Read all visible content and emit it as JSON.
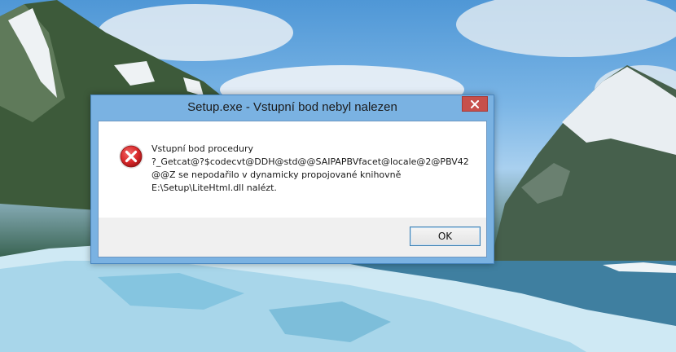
{
  "dialog": {
    "title": "Setup.exe - Vstupní bod nebyl nalezen",
    "message_lines": [
      "Vstupní bod procedury",
      "?_Getcat@?$codecvt@DDH@std@@SAIPAPBVfacet@locale@2@PBV42",
      "@@Z se nepodařilo v dynamicky propojované knihovně",
      "E:\\Setup\\LiteHtml.dll nalézt."
    ],
    "ok_label": "OK",
    "icons": {
      "close": "close-icon",
      "error": "error-icon"
    },
    "colors": {
      "close_button": "#c7504b",
      "frame": "#7ab2e2",
      "error_icon": "#d9292b"
    }
  }
}
